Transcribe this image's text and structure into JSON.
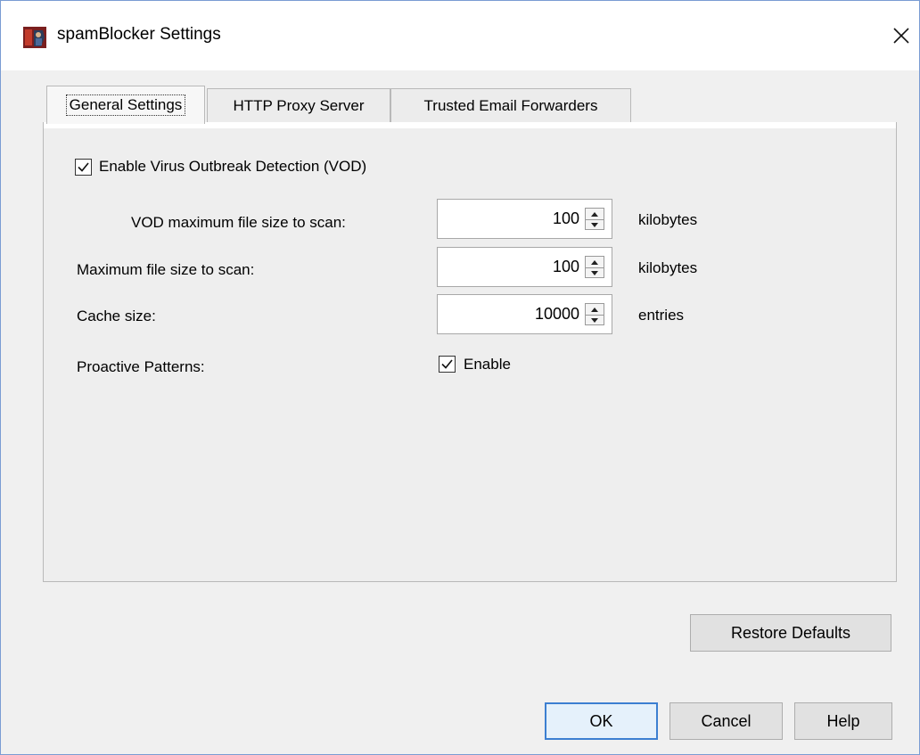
{
  "window": {
    "title": "spamBlocker Settings",
    "icon": "watchguard-app-icon",
    "close_icon": "close-icon"
  },
  "tabs": [
    {
      "label": "General Settings",
      "active": true
    },
    {
      "label": "HTTP Proxy Server",
      "active": false
    },
    {
      "label": "Trusted Email Forwarders",
      "active": false
    }
  ],
  "general": {
    "vod_checkbox": {
      "label": "Enable Virus Outbreak Detection (VOD)",
      "checked": true
    },
    "vod_max_size": {
      "label": "VOD maximum file size to scan:",
      "value": "100",
      "unit": "kilobytes"
    },
    "max_size": {
      "label": "Maximum file size to scan:",
      "value": "100",
      "unit": "kilobytes"
    },
    "cache_size": {
      "label": "Cache size:",
      "value": "10000",
      "unit": "entries"
    },
    "proactive": {
      "label": "Proactive Patterns:",
      "checkbox_label": "Enable",
      "checked": true
    }
  },
  "buttons": {
    "restore": "Restore Defaults",
    "ok": "OK",
    "cancel": "Cancel",
    "help": "Help"
  },
  "colors": {
    "default_button_border": "#3c7fd1",
    "default_button_bg": "#e5f1fb"
  }
}
